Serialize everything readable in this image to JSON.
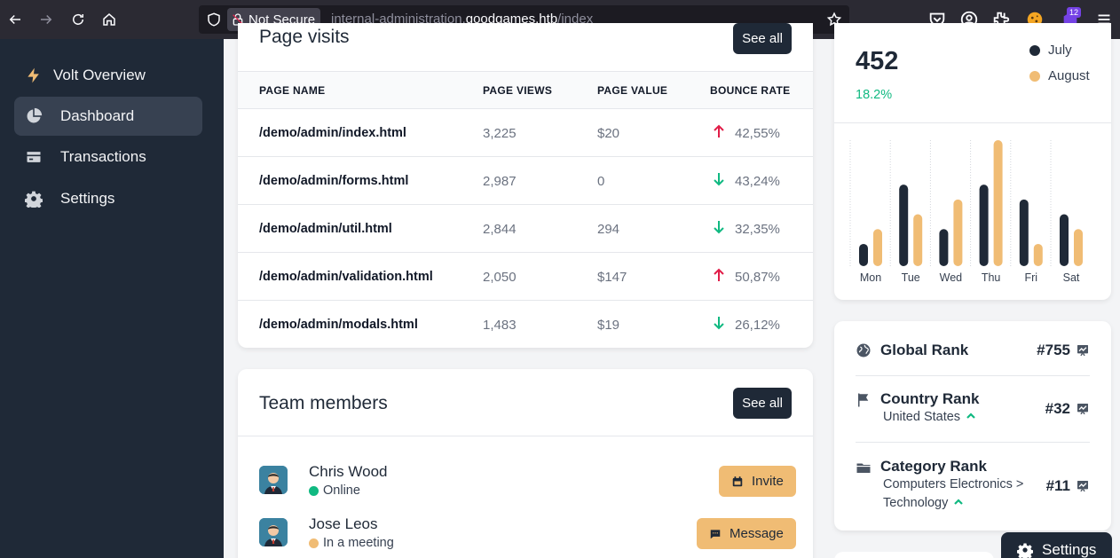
{
  "browser": {
    "not_secure_label": "Not Secure",
    "url_prefix": "internal-administration.",
    "url_host": "goodgames.htb",
    "url_path": "/index",
    "extension_badge": "12"
  },
  "sidebar": {
    "brand": "Volt Overview",
    "items": [
      {
        "label": "Dashboard",
        "icon": "chart-pie-icon"
      },
      {
        "label": "Transactions",
        "icon": "credit-card-icon"
      },
      {
        "label": "Settings",
        "icon": "gear-icon"
      }
    ]
  },
  "page_visits": {
    "title": "Page visits",
    "see_all": "See all",
    "headers": [
      "PAGE NAME",
      "PAGE VIEWS",
      "PAGE VALUE",
      "BOUNCE RATE"
    ],
    "rows": [
      {
        "name": "/demo/admin/index.html",
        "views": "3,225",
        "value": "$20",
        "trend": "up",
        "rate": "42,55%"
      },
      {
        "name": "/demo/admin/forms.html",
        "views": "2,987",
        "value": "0",
        "trend": "down",
        "rate": "43,24%"
      },
      {
        "name": "/demo/admin/util.html",
        "views": "2,844",
        "value": "294",
        "trend": "down",
        "rate": "32,35%"
      },
      {
        "name": "/demo/admin/validation.html",
        "views": "2,050",
        "value": "$147",
        "trend": "up",
        "rate": "50,87%"
      },
      {
        "name": "/demo/admin/modals.html",
        "views": "1,483",
        "value": "$19",
        "trend": "down",
        "rate": "26,12%"
      }
    ]
  },
  "team": {
    "title": "Team members",
    "see_all": "See all",
    "members": [
      {
        "name": "Chris Wood",
        "status": "Online",
        "status_color": "#10b981",
        "action": "Invite",
        "action_icon": "calendar-icon"
      },
      {
        "name": "Jose Leos",
        "status": "In a meeting",
        "status_color": "#f0bc74",
        "action": "Message",
        "action_icon": "chat-icon"
      }
    ]
  },
  "stats": {
    "value": "452",
    "change": "18.2%",
    "legend": [
      {
        "name": "July",
        "color": "#1f2937"
      },
      {
        "name": "August",
        "color": "#f0bc74"
      }
    ]
  },
  "chart_data": {
    "type": "bar",
    "categories": [
      "Mon",
      "Tue",
      "Wed",
      "Thu",
      "Fri",
      "Sat"
    ],
    "series": [
      {
        "name": "July",
        "values": [
          15,
          55,
          25,
          55,
          45,
          35
        ]
      },
      {
        "name": "August",
        "values": [
          25,
          35,
          45,
          85,
          15,
          25
        ]
      }
    ],
    "title": "",
    "xlabel": "",
    "ylabel": "",
    "ylim": [
      0,
      85
    ],
    "grid": "vertical dotted"
  },
  "ranks": [
    {
      "title": "Global Rank",
      "value": "#755",
      "icon": "globe-icon",
      "sub": ""
    },
    {
      "title": "Country Rank",
      "value": "#32",
      "icon": "flag-icon",
      "sub": "United States"
    },
    {
      "title": "Category Rank",
      "value": "#11",
      "icon": "folder-icon",
      "sub": "Computers Electronics > Technology"
    }
  ],
  "settings_label": "Settings"
}
